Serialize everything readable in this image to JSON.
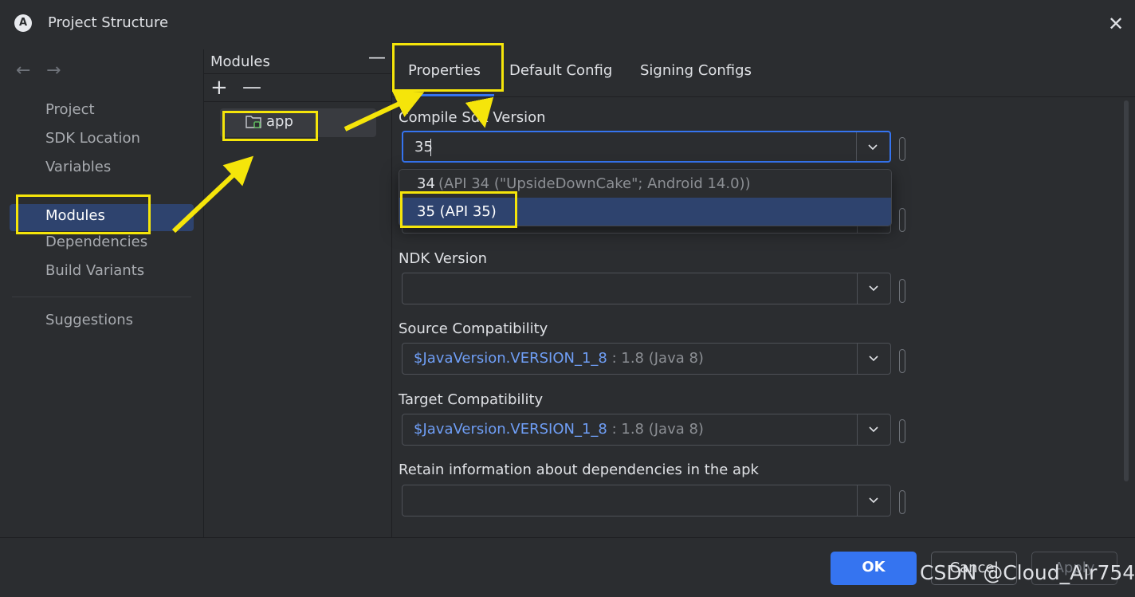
{
  "window": {
    "title": "Project Structure",
    "logo_letter": "A",
    "close_glyph": "✕"
  },
  "nav": {
    "back_glyph": "←",
    "forward_glyph": "→"
  },
  "sidebar": {
    "items": [
      {
        "label": "Project"
      },
      {
        "label": "SDK Location"
      },
      {
        "label": "Variables"
      },
      {
        "label": "Modules",
        "selected": true
      },
      {
        "label": "Dependencies"
      },
      {
        "label": "Build Variants"
      },
      {
        "label": "Suggestions"
      }
    ]
  },
  "modules": {
    "title": "Modules",
    "collapse_glyph": "—",
    "add_glyph": "+",
    "remove_glyph": "—",
    "items": [
      {
        "label": "app",
        "icon": "module-folder-icon"
      }
    ]
  },
  "tabs": [
    {
      "label": "Properties",
      "selected": true
    },
    {
      "label": "Default Config"
    },
    {
      "label": "Signing Configs"
    }
  ],
  "fields": {
    "compile_sdk": {
      "label": "Compile Sdk Version",
      "value": "35"
    },
    "ndk": {
      "label": "NDK Version",
      "value": ""
    },
    "source_compat": {
      "label": "Source Compatibility",
      "value_main": "$JavaVersion.VERSION_1_8",
      "value_hint": " : 1.8 (Java 8)"
    },
    "target_compat": {
      "label": "Target Compatibility",
      "value_main": "$JavaVersion.VERSION_1_8",
      "value_hint": " : 1.8 (Java 8)"
    },
    "retain_deps": {
      "label": "Retain information about dependencies in the apk",
      "value": ""
    }
  },
  "dropdown": {
    "options": [
      {
        "value": "34",
        "hint": " (API 34 (\"UpsideDownCake\"; Android 14.0))"
      },
      {
        "value": "35 (API 35)",
        "hint": "",
        "selected": true
      }
    ]
  },
  "footer": {
    "ok": "OK",
    "cancel": "Cancel",
    "apply": "Apply"
  },
  "watermark": "CSDN @Cloud_Air754",
  "colors": {
    "background": "#2b2d30",
    "accent": "#3574f0",
    "selection": "#2e436e",
    "annotation": "#f5e50a",
    "link_value": "#6f9ef5"
  }
}
